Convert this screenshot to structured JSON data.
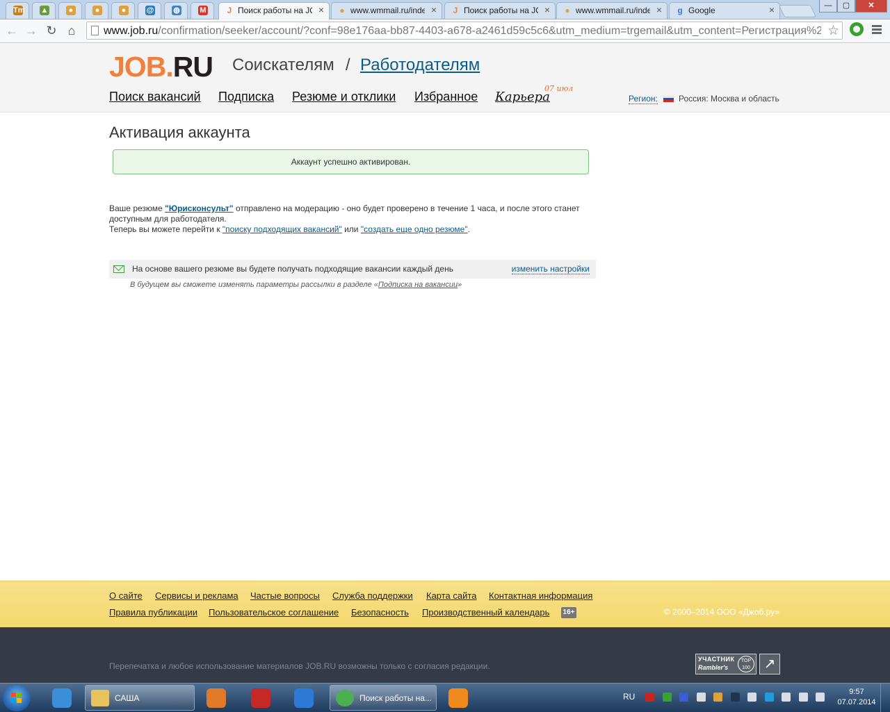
{
  "browser": {
    "pinned_tabs": [
      {
        "icon": "tm-icon",
        "glyph": "Tm",
        "color": "#c97d16"
      },
      {
        "icon": "landscape-icon",
        "glyph": "▲",
        "color": "#6a9a3a"
      },
      {
        "icon": "wmmail-icon",
        "glyph": "●",
        "color": "#e0a03c"
      },
      {
        "icon": "wmmail-icon",
        "glyph": "●",
        "color": "#e0a03c"
      },
      {
        "icon": "wmmail-icon",
        "glyph": "●",
        "color": "#e0a03c"
      },
      {
        "icon": "mail-at-icon",
        "glyph": "@",
        "color": "#2c7bbf"
      },
      {
        "icon": "globe-icon",
        "glyph": "◍",
        "color": "#3c84c6"
      },
      {
        "icon": "gmail-icon",
        "glyph": "M",
        "color": "#d9372b"
      }
    ],
    "tabs": [
      {
        "title": "Поиск работы на JOB.RU",
        "icon": "job-ru-icon",
        "glyph": "J",
        "color": "#f0803c",
        "active": true
      },
      {
        "title": "www.wmmail.ru/index.php",
        "icon": "wmmail-icon",
        "glyph": "●",
        "color": "#e0a03c",
        "active": false
      },
      {
        "title": "Поиск работы на JOB.RU",
        "icon": "job-ru-icon",
        "glyph": "J",
        "color": "#f0803c",
        "active": false
      },
      {
        "title": "www.wmmail.ru/index.php",
        "icon": "wmmail-icon",
        "glyph": "●",
        "color": "#e0a03c",
        "active": false
      },
      {
        "title": "Google",
        "icon": "google-icon",
        "glyph": "g",
        "color": "#3c7be0",
        "active": false
      }
    ],
    "url_host": "www.job.ru",
    "url_path": "/confirmation/seeker/account/?conf=98e176aa-bb87-4403-a678-a2461d59c5c6&utm_medium=trgemail&utm_content=Регистрация%2",
    "window_controls": {
      "minimize": "—",
      "maximize": "▢",
      "close": "✕"
    }
  },
  "site": {
    "logo": {
      "job": "JOB",
      "dot": ".",
      "ru": "RU"
    },
    "audience": {
      "seekers": "Соискателям",
      "separator": "/",
      "employers": "Работодателям"
    },
    "nav": [
      "Поиск вакансий",
      "Подписка",
      "Резюме и отклики",
      "Избранное",
      "Карьера"
    ],
    "career_date": "07 июл",
    "region_label": "Регион:",
    "region_value": "Россия: Москва и область"
  },
  "content": {
    "title": "Активация аккаунта",
    "success": "Аккаунт успешно активирован.",
    "resume_prefix": "Ваше резюме ",
    "resume_name": "\"Юрисконсульт\"",
    "resume_suffix": " отправлено на модерацию - оно будет проверено в течение 1 часа, и после этого станет доступным для работодателя.",
    "next_prefix": "Теперь вы можете перейти к ",
    "next_link1": "\"поиску подходящих вакансий\"",
    "next_middle": " или ",
    "next_link2": "\"создать еще одно резюме\"",
    "next_suffix": ".",
    "subscription_text": "На основе вашего резюме вы будете получать подходящие вакансии каждый день",
    "subscription_settings": "изменить настройки",
    "note_prefix": "В будущем вы сможете изменять параметры рассылки в разделе «",
    "note_link": "Подписка на вакансии",
    "note_suffix": "»"
  },
  "footer": {
    "row1": [
      "О сайте",
      "Сервисы и реклама",
      "Частые вопросы",
      "Служба поддержки",
      "Карта сайта",
      "Контактная информация"
    ],
    "row2": [
      "Правила публикации",
      "Пользовательское соглашение",
      "Безопасность",
      "Производственный календарь"
    ],
    "age": "16+",
    "copyright": "© 2000–2014 ООО «Джоб.ру»",
    "reprint": "Перепечатка и любое использование материалов JOB.RU возможны только с согласия редакции.",
    "rambler_line1": "УЧАСТНИК",
    "rambler_line2": "Rambler's",
    "rambler_top": "TOP 100"
  },
  "taskbar": {
    "pinned": [
      {
        "icon": "ie-icon",
        "color": "#3b8fd8"
      },
      {
        "icon": "media-player-icon",
        "color": "#e07a2a"
      },
      {
        "icon": "zynga-icon",
        "color": "#c62828"
      },
      {
        "icon": "mail-agent-icon",
        "color": "#2d7ad6"
      },
      {
        "icon": "odnoklassniki-icon",
        "color": "#f08a1c"
      }
    ],
    "tasks": [
      {
        "title": "САША",
        "icon": "folder-icon"
      },
      {
        "title": "Поиск работы на...",
        "icon": "chrome-icon"
      }
    ],
    "lang": "RU",
    "time": "9:57",
    "date": "07.07.2014",
    "tray": [
      {
        "icon": "adobe-icon",
        "color": "#c8261c"
      },
      {
        "icon": "network-green-icon",
        "color": "#3aa12c"
      },
      {
        "icon": "flag-ru-icon",
        "color": "#3b5bd9"
      },
      {
        "icon": "disk-icon",
        "color": "#d9dde3"
      },
      {
        "icon": "wmmail-tray-icon",
        "color": "#e0a03c"
      },
      {
        "icon": "monitor-icon",
        "color": "#20344c"
      },
      {
        "icon": "speaker-icon",
        "color": "#d9dde3"
      },
      {
        "icon": "skype-icon",
        "color": "#1f9bde"
      },
      {
        "icon": "action-center-flag-icon",
        "color": "#d9dde3"
      },
      {
        "icon": "network-icon",
        "color": "#d9dde3"
      },
      {
        "icon": "power-icon",
        "color": "#d9dde3"
      }
    ]
  }
}
